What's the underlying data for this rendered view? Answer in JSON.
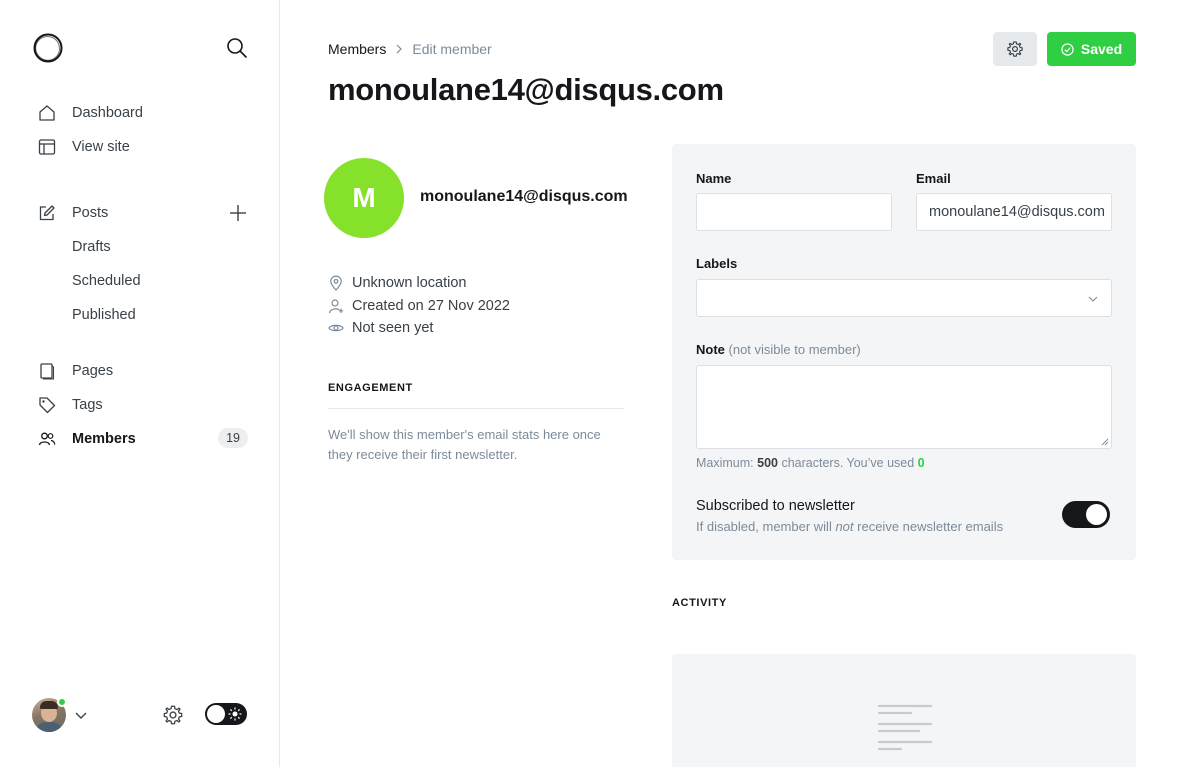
{
  "sidebar": {
    "logo_icon": "ghost-logo-icon",
    "search_icon": "search-icon",
    "items": [
      {
        "label": "Dashboard",
        "icon": "home-icon"
      },
      {
        "label": "View site",
        "icon": "layout-icon"
      },
      {
        "label": "Posts",
        "icon": "edit-icon"
      },
      {
        "label": "Drafts"
      },
      {
        "label": "Scheduled"
      },
      {
        "label": "Published"
      },
      {
        "label": "Pages",
        "icon": "page-icon"
      },
      {
        "label": "Tags",
        "icon": "tag-icon"
      },
      {
        "label": "Members",
        "icon": "members-icon",
        "count": "19"
      }
    ],
    "footer": {
      "online_color": "#30cf43"
    }
  },
  "header": {
    "breadcrumb_parent": "Members",
    "breadcrumb_current": "Edit member",
    "title": "monoulane14@disqus.com",
    "saved_label": "Saved",
    "saved_color": "#30cf43"
  },
  "member": {
    "initial": "M",
    "avatar_color": "#85e12a",
    "email": "monoulane14@disqus.com",
    "location": "Unknown location",
    "created": "Created on 27 Nov 2022",
    "seen": "Not seen yet",
    "engagement_heading": "ENGAGEMENT",
    "engagement_text": "We'll show this member's email stats here once they receive their first newsletter."
  },
  "form": {
    "name_label": "Name",
    "name_value": "",
    "email_label": "Email",
    "email_value": "monoulane14@disqus.com",
    "labels_label": "Labels",
    "note_label": "Note",
    "note_hint": "(not visible to member)",
    "counter_prefix": "Maximum: ",
    "counter_max": "500",
    "counter_mid": " characters. You’ve used ",
    "counter_used": "0",
    "newsletter_title": "Subscribed to newsletter",
    "newsletter_sub_prefix": "If disabled, member will ",
    "newsletter_sub_em": "not",
    "newsletter_sub_suffix": " receive newsletter emails",
    "newsletter_enabled": true
  },
  "activity": {
    "heading": "ACTIVITY"
  }
}
